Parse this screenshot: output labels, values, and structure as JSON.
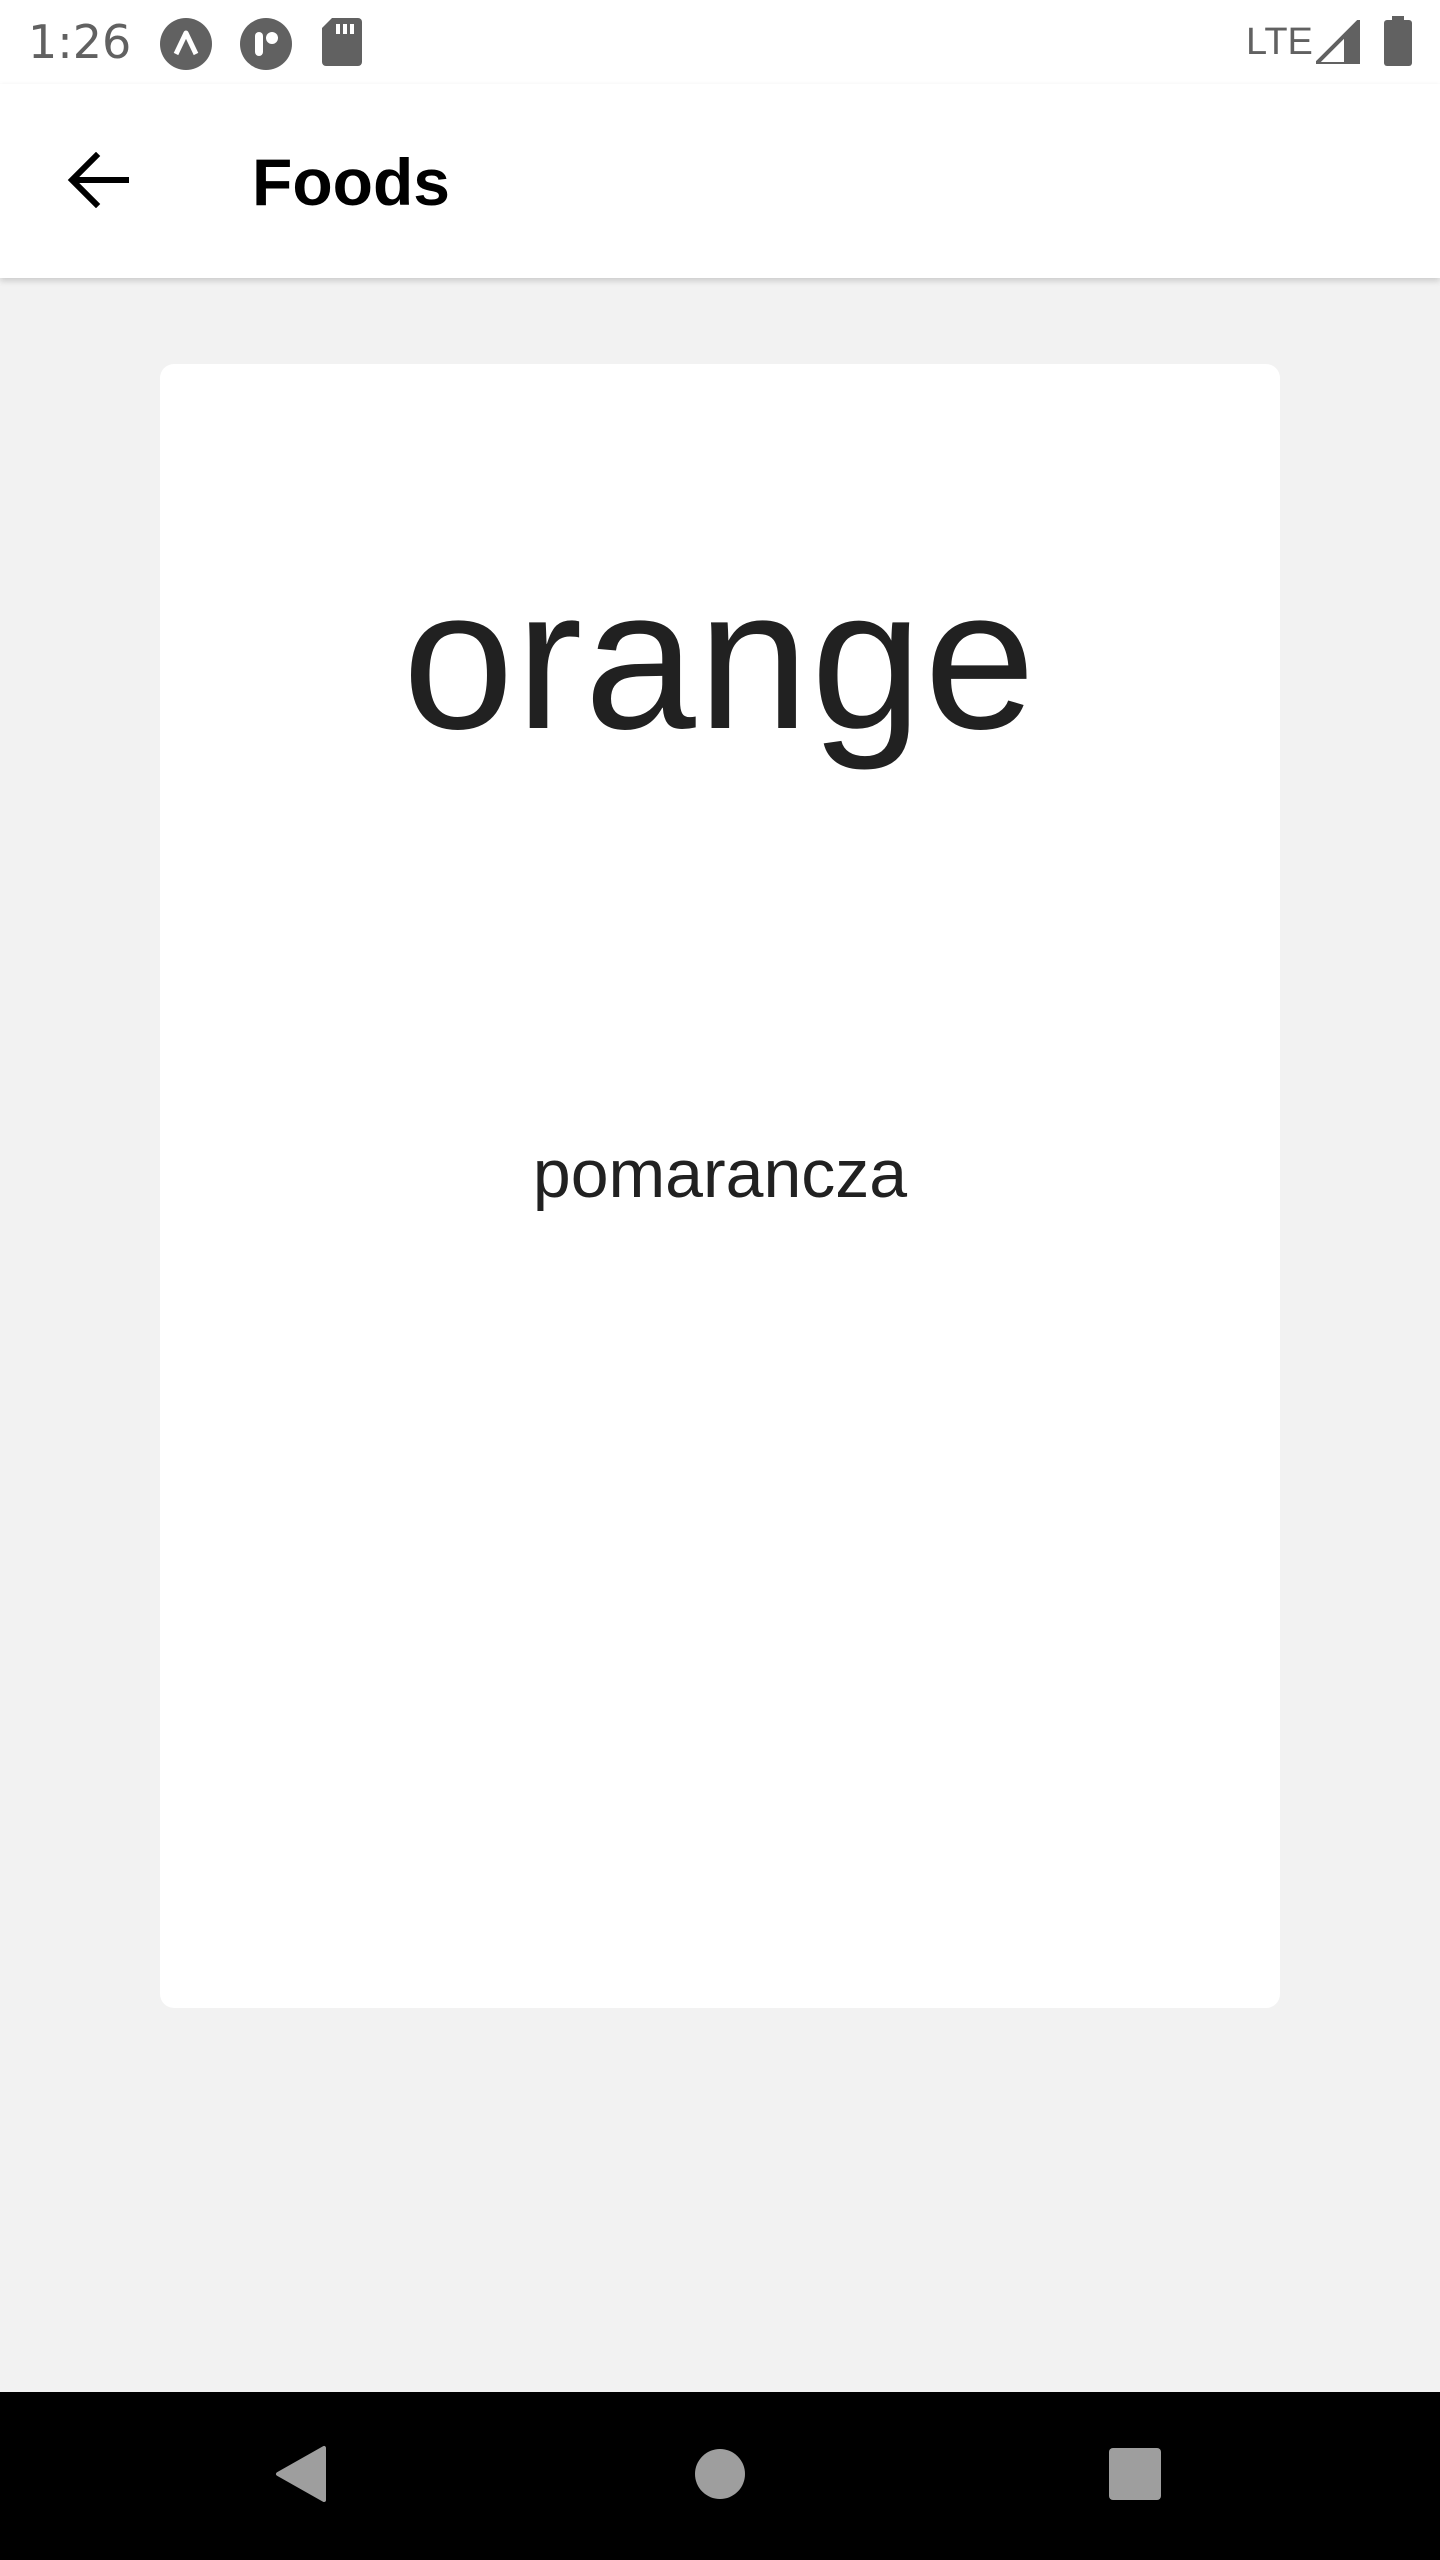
{
  "status_bar": {
    "time": "1:26",
    "network": "LTE",
    "icons": [
      "arrow-up-circle-icon",
      "r-circle-icon",
      "sd-card-icon",
      "signal-icon",
      "battery-icon"
    ]
  },
  "app_bar": {
    "title": "Foods",
    "back_icon": "arrow-back-icon"
  },
  "card": {
    "word": "orange",
    "translation": "pomarancza"
  },
  "nav_bar": {
    "icons": [
      "back-triangle-icon",
      "home-circle-icon",
      "recents-square-icon"
    ]
  },
  "colors": {
    "background": "#f2f2f2",
    "surface": "#ffffff",
    "text": "#212121",
    "status": "#616161",
    "nav": "#000000"
  }
}
